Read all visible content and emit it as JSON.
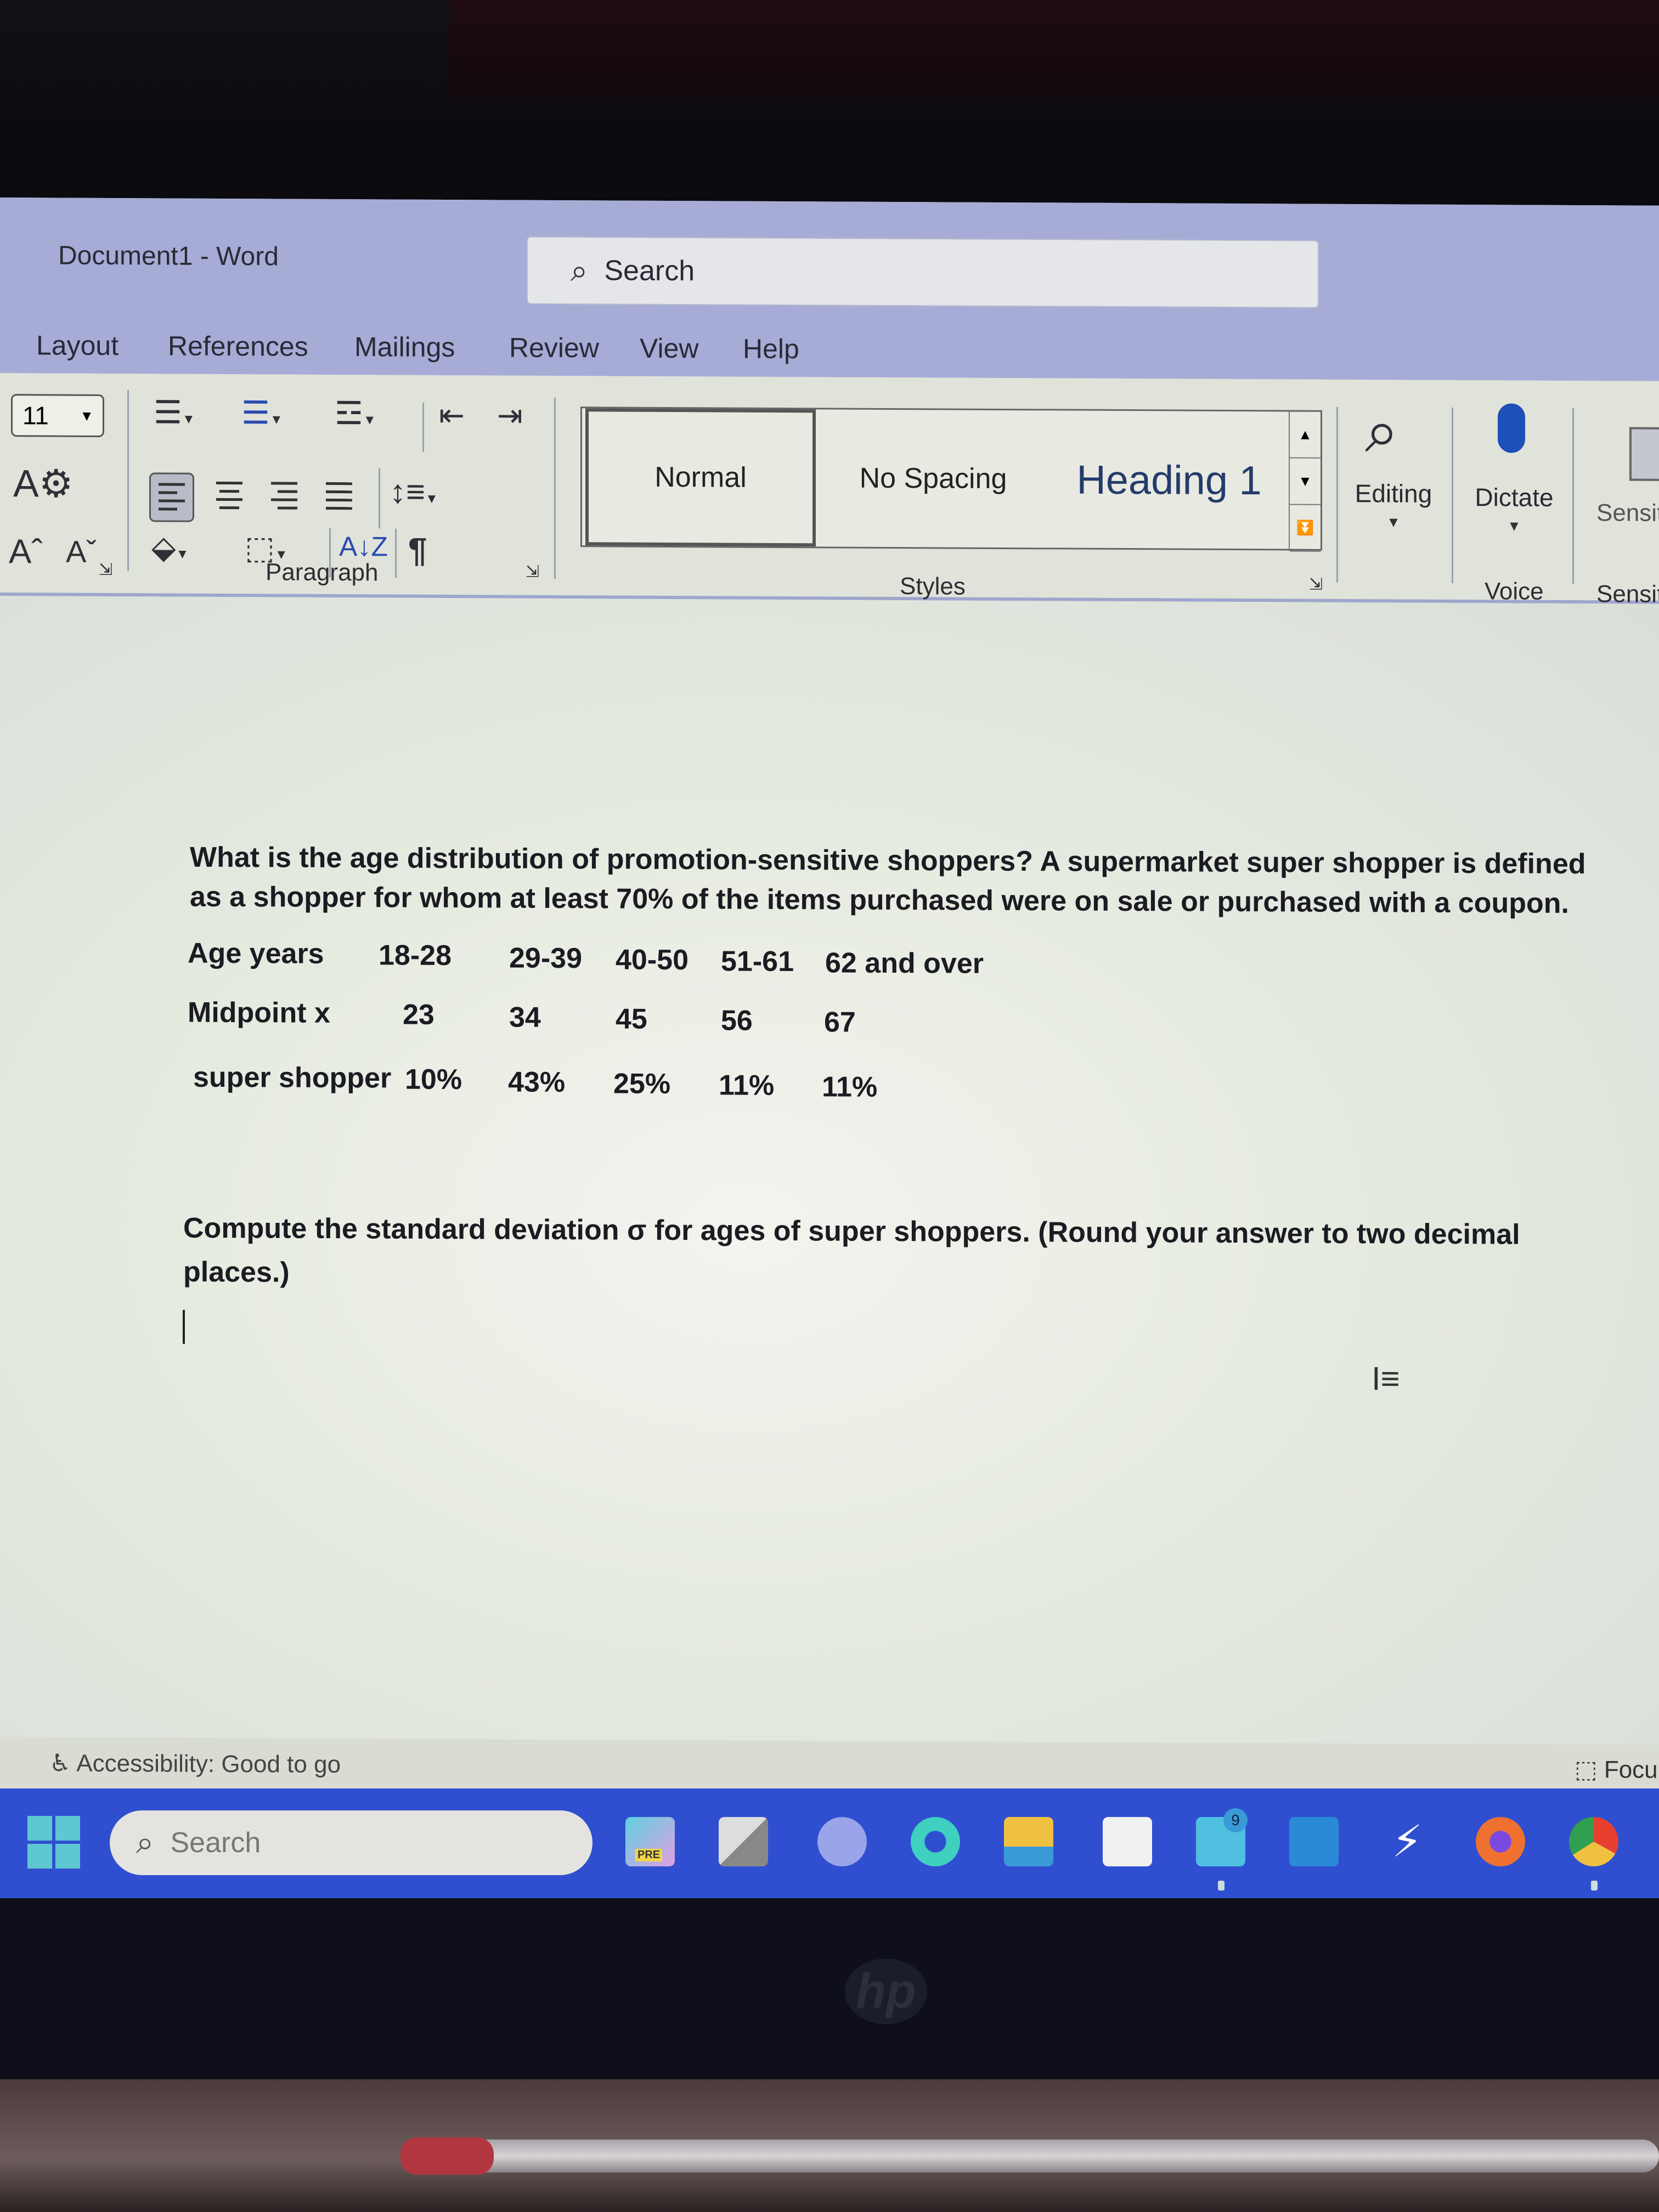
{
  "window": {
    "title": "Document1 - Word",
    "search_placeholder": "Search"
  },
  "ribbon_tabs": [
    "Layout",
    "References",
    "Mailings",
    "Review",
    "View",
    "Help"
  ],
  "ribbon": {
    "font_size": "11",
    "paragraph_group_label": "Paragraph",
    "styles": [
      "Normal",
      "No Spacing",
      "Heading 1"
    ],
    "selected_style": "Normal",
    "styles_group_label": "Styles",
    "editing_label": "Editing",
    "dictate_label": "Dictate",
    "voice_group_label": "Voice",
    "sensitivity_label": "Sensit",
    "sensitivity_group_label": "Sensit",
    "icons": {
      "text_effects": "A⚙",
      "grow_font": "Aˆ",
      "shrink_font": "Aˇ",
      "sort": "A↓Z",
      "show_marks": "¶"
    }
  },
  "document": {
    "intro_line1": "What is the age distribution of promotion-sensitive shoppers? A supermarket super shopper is defined",
    "intro_line2": "as a shopper for whom at least 70% of the items purchased were on sale or purchased with a coupon.",
    "table": {
      "rows": [
        {
          "label": "Age years",
          "values": [
            "18-28",
            "29-39",
            "40-50",
            "51-61",
            "62 and over"
          ]
        },
        {
          "label": "Midpoint x",
          "values": [
            "23",
            "34",
            "45",
            "56",
            "67"
          ]
        },
        {
          "label": "super shopper",
          "values": [
            "10%",
            "43%",
            "25%",
            "11%",
            "11%"
          ]
        }
      ]
    },
    "question_line1": "Compute the standard deviation σ for ages of super shoppers. (Round your answer to two decimal",
    "question_line2": "places.)"
  },
  "status_bar": {
    "accessibility": "Accessibility: Good to go",
    "focus": "Focu"
  },
  "taskbar": {
    "search_placeholder": "Search",
    "copilot_badge": "PRE",
    "mail_badge": "9",
    "apps": [
      "copilot",
      "task-view",
      "teams-chat",
      "edge",
      "file-explorer",
      "microsoft-store",
      "mail",
      "dropbox",
      "power-automate",
      "firefox",
      "chrome"
    ]
  },
  "hardware": {
    "logo": "hp"
  }
}
